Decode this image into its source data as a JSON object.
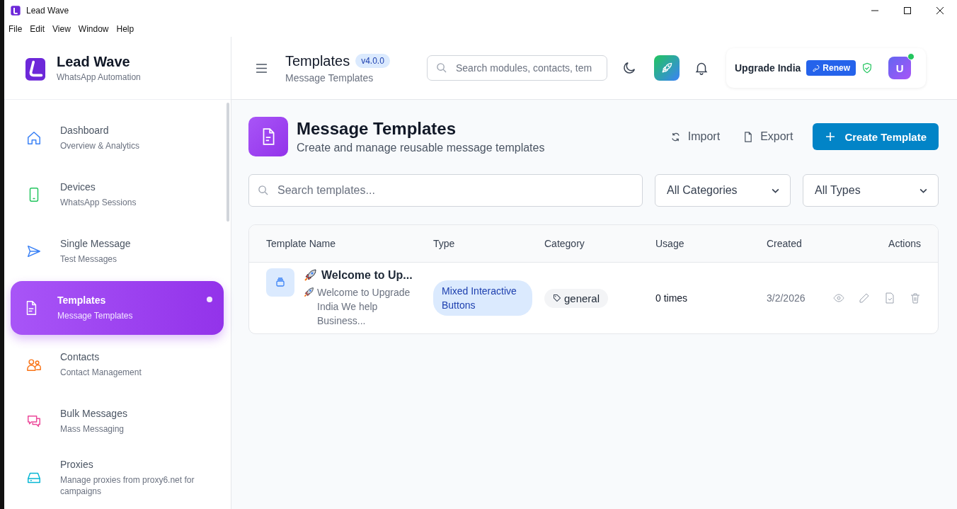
{
  "window": {
    "title": "Lead Wave"
  },
  "menu": [
    "File",
    "Edit",
    "View",
    "Window",
    "Help"
  ],
  "brand": {
    "name": "Lead Wave",
    "tagline": "WhatsApp Automation"
  },
  "sidebar": {
    "items": [
      {
        "kind": "home",
        "label": "Dashboard",
        "sub": "Overview & Analytics",
        "selected": false
      },
      {
        "kind": "phone",
        "label": "Devices",
        "sub": "WhatsApp Sessions",
        "selected": false
      },
      {
        "kind": "send",
        "label": "Single Message",
        "sub": "Test Messages",
        "selected": false
      },
      {
        "kind": "file",
        "label": "Templates",
        "sub": "Message Templates",
        "selected": true
      },
      {
        "kind": "users",
        "label": "Contacts",
        "sub": "Contact Management",
        "selected": false
      },
      {
        "kind": "chat",
        "label": "Bulk Messages",
        "sub": "Mass Messaging",
        "selected": false
      },
      {
        "kind": "server",
        "label": "Proxies",
        "sub": "Manage proxies from proxy6.net for campaigns",
        "selected": false
      }
    ]
  },
  "header": {
    "title": "Templates",
    "version": "v4.0.0",
    "subtitle": "Message Templates",
    "search_placeholder": "Search modules, contacts, tem",
    "org": "Upgrade India",
    "renew": "Renew",
    "avatar": "U"
  },
  "page": {
    "title": "Message Templates",
    "subtitle": "Create and manage reusable message templates",
    "import": "Import",
    "export": "Export",
    "create": "Create Template"
  },
  "filters": {
    "search_placeholder": "Search templates...",
    "category": "All Categories",
    "type": "All Types"
  },
  "table": {
    "columns": [
      "Template Name",
      "Type",
      "Category",
      "Usage",
      "Created",
      "Actions"
    ],
    "rows": [
      {
        "name": "Welcome to Up...",
        "preview": "Welcome to Upgrade India We help Business...",
        "type": "Mixed Interactive Buttons",
        "category": "general",
        "usage": "0 times",
        "created": "3/2/2026"
      }
    ]
  }
}
